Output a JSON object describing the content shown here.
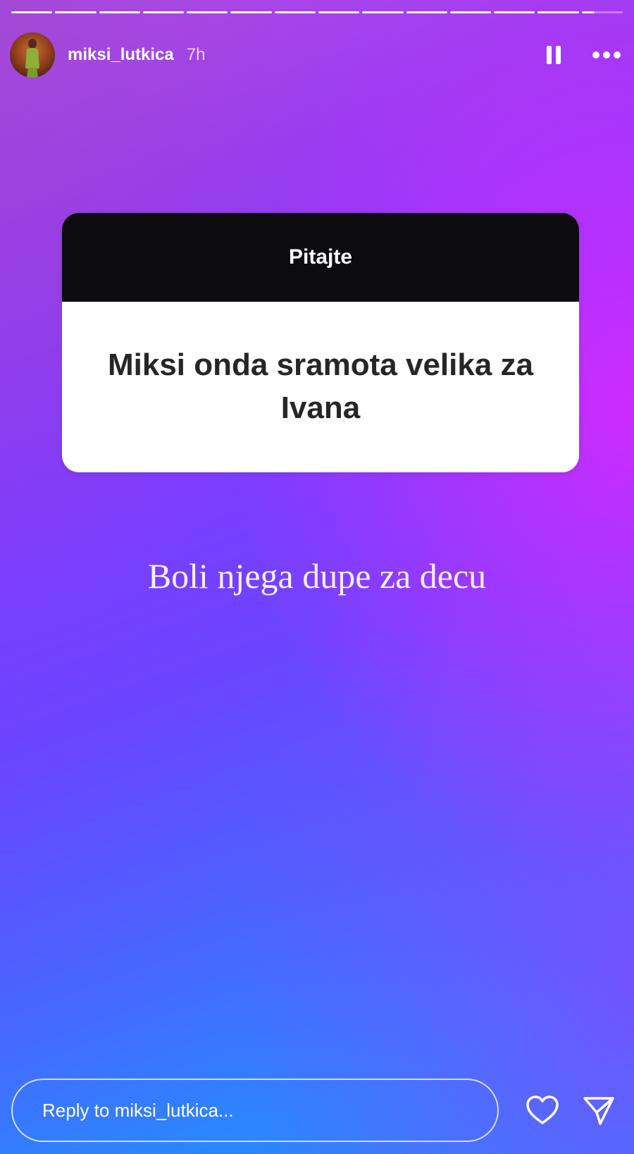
{
  "story": {
    "username": "miksi_lutkica",
    "time_ago": "7h",
    "segments_total": 14,
    "segments_completed": 13,
    "current_segment_progress": 0.3
  },
  "question_sticker": {
    "title": "Pitajte",
    "question": "Miksi onda sramota velika za Ivana"
  },
  "answer_text": "Boli njega dupe za decu",
  "reply": {
    "placeholder": "Reply to miksi_lutkica..."
  },
  "icons": {
    "pause": "pause-icon",
    "more": "more-horizontal-icon",
    "like": "heart-icon",
    "share": "send-icon"
  },
  "colors": {
    "gradient_top": "#b44ce8",
    "gradient_mid": "#7f3bff",
    "gradient_bottom": "#1f8fff",
    "sticker_header": "#0c0c0e",
    "sticker_body": "#ffffff"
  }
}
